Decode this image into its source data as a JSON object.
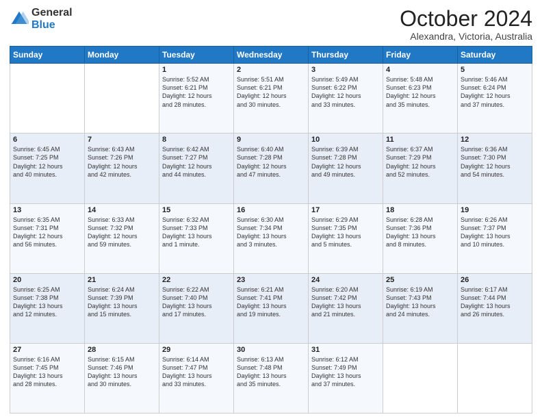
{
  "logo": {
    "general": "General",
    "blue": "Blue"
  },
  "header": {
    "month_year": "October 2024",
    "location": "Alexandra, Victoria, Australia"
  },
  "weekdays": [
    "Sunday",
    "Monday",
    "Tuesday",
    "Wednesday",
    "Thursday",
    "Friday",
    "Saturday"
  ],
  "weeks": [
    [
      {
        "day": "",
        "info": ""
      },
      {
        "day": "",
        "info": ""
      },
      {
        "day": "1",
        "info": "Sunrise: 5:52 AM\nSunset: 6:21 PM\nDaylight: 12 hours\nand 28 minutes."
      },
      {
        "day": "2",
        "info": "Sunrise: 5:51 AM\nSunset: 6:21 PM\nDaylight: 12 hours\nand 30 minutes."
      },
      {
        "day": "3",
        "info": "Sunrise: 5:49 AM\nSunset: 6:22 PM\nDaylight: 12 hours\nand 33 minutes."
      },
      {
        "day": "4",
        "info": "Sunrise: 5:48 AM\nSunset: 6:23 PM\nDaylight: 12 hours\nand 35 minutes."
      },
      {
        "day": "5",
        "info": "Sunrise: 5:46 AM\nSunset: 6:24 PM\nDaylight: 12 hours\nand 37 minutes."
      }
    ],
    [
      {
        "day": "6",
        "info": "Sunrise: 6:45 AM\nSunset: 7:25 PM\nDaylight: 12 hours\nand 40 minutes."
      },
      {
        "day": "7",
        "info": "Sunrise: 6:43 AM\nSunset: 7:26 PM\nDaylight: 12 hours\nand 42 minutes."
      },
      {
        "day": "8",
        "info": "Sunrise: 6:42 AM\nSunset: 7:27 PM\nDaylight: 12 hours\nand 44 minutes."
      },
      {
        "day": "9",
        "info": "Sunrise: 6:40 AM\nSunset: 7:28 PM\nDaylight: 12 hours\nand 47 minutes."
      },
      {
        "day": "10",
        "info": "Sunrise: 6:39 AM\nSunset: 7:28 PM\nDaylight: 12 hours\nand 49 minutes."
      },
      {
        "day": "11",
        "info": "Sunrise: 6:37 AM\nSunset: 7:29 PM\nDaylight: 12 hours\nand 52 minutes."
      },
      {
        "day": "12",
        "info": "Sunrise: 6:36 AM\nSunset: 7:30 PM\nDaylight: 12 hours\nand 54 minutes."
      }
    ],
    [
      {
        "day": "13",
        "info": "Sunrise: 6:35 AM\nSunset: 7:31 PM\nDaylight: 12 hours\nand 56 minutes."
      },
      {
        "day": "14",
        "info": "Sunrise: 6:33 AM\nSunset: 7:32 PM\nDaylight: 12 hours\nand 59 minutes."
      },
      {
        "day": "15",
        "info": "Sunrise: 6:32 AM\nSunset: 7:33 PM\nDaylight: 13 hours\nand 1 minute."
      },
      {
        "day": "16",
        "info": "Sunrise: 6:30 AM\nSunset: 7:34 PM\nDaylight: 13 hours\nand 3 minutes."
      },
      {
        "day": "17",
        "info": "Sunrise: 6:29 AM\nSunset: 7:35 PM\nDaylight: 13 hours\nand 5 minutes."
      },
      {
        "day": "18",
        "info": "Sunrise: 6:28 AM\nSunset: 7:36 PM\nDaylight: 13 hours\nand 8 minutes."
      },
      {
        "day": "19",
        "info": "Sunrise: 6:26 AM\nSunset: 7:37 PM\nDaylight: 13 hours\nand 10 minutes."
      }
    ],
    [
      {
        "day": "20",
        "info": "Sunrise: 6:25 AM\nSunset: 7:38 PM\nDaylight: 13 hours\nand 12 minutes."
      },
      {
        "day": "21",
        "info": "Sunrise: 6:24 AM\nSunset: 7:39 PM\nDaylight: 13 hours\nand 15 minutes."
      },
      {
        "day": "22",
        "info": "Sunrise: 6:22 AM\nSunset: 7:40 PM\nDaylight: 13 hours\nand 17 minutes."
      },
      {
        "day": "23",
        "info": "Sunrise: 6:21 AM\nSunset: 7:41 PM\nDaylight: 13 hours\nand 19 minutes."
      },
      {
        "day": "24",
        "info": "Sunrise: 6:20 AM\nSunset: 7:42 PM\nDaylight: 13 hours\nand 21 minutes."
      },
      {
        "day": "25",
        "info": "Sunrise: 6:19 AM\nSunset: 7:43 PM\nDaylight: 13 hours\nand 24 minutes."
      },
      {
        "day": "26",
        "info": "Sunrise: 6:17 AM\nSunset: 7:44 PM\nDaylight: 13 hours\nand 26 minutes."
      }
    ],
    [
      {
        "day": "27",
        "info": "Sunrise: 6:16 AM\nSunset: 7:45 PM\nDaylight: 13 hours\nand 28 minutes."
      },
      {
        "day": "28",
        "info": "Sunrise: 6:15 AM\nSunset: 7:46 PM\nDaylight: 13 hours\nand 30 minutes."
      },
      {
        "day": "29",
        "info": "Sunrise: 6:14 AM\nSunset: 7:47 PM\nDaylight: 13 hours\nand 33 minutes."
      },
      {
        "day": "30",
        "info": "Sunrise: 6:13 AM\nSunset: 7:48 PM\nDaylight: 13 hours\nand 35 minutes."
      },
      {
        "day": "31",
        "info": "Sunrise: 6:12 AM\nSunset: 7:49 PM\nDaylight: 13 hours\nand 37 minutes."
      },
      {
        "day": "",
        "info": ""
      },
      {
        "day": "",
        "info": ""
      }
    ]
  ]
}
